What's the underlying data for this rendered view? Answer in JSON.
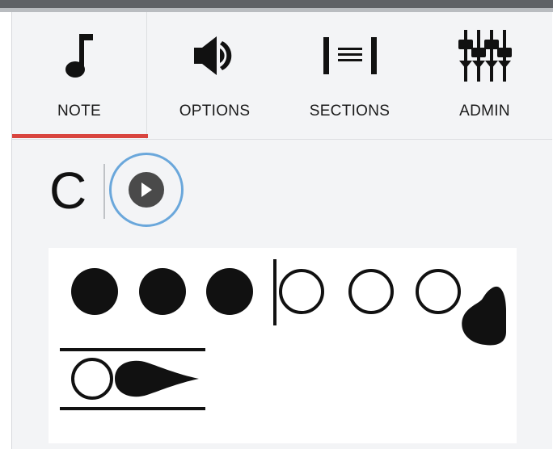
{
  "tabs": [
    {
      "label": "NOTE",
      "icon": "music-note-icon",
      "active": true
    },
    {
      "label": "OPTIONS",
      "icon": "speaker-icon",
      "active": false
    },
    {
      "label": "SECTIONS",
      "icon": "sections-icon",
      "active": false
    },
    {
      "label": "ADMIN",
      "icon": "sliders-icon",
      "active": false
    }
  ],
  "note": {
    "name": "C"
  },
  "colors": {
    "accent": "#d9453f",
    "play_ring": "#6aa7db",
    "panel_bg": "#f3f4f6"
  },
  "fingering_chart": {
    "left_hand": [
      "closed",
      "closed",
      "closed"
    ],
    "right_hand": [
      "open",
      "open",
      "open"
    ],
    "right_key": "closed",
    "octave_key": "half"
  }
}
